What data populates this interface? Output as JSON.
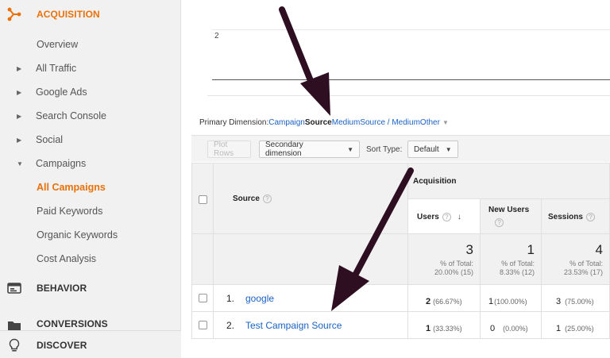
{
  "sidebar": {
    "acquisition": "ACQUISITION",
    "items": [
      {
        "label": "Overview"
      },
      {
        "label": "All Traffic"
      },
      {
        "label": "Google Ads"
      },
      {
        "label": "Search Console"
      },
      {
        "label": "Social"
      },
      {
        "label": "Campaigns"
      },
      {
        "label": "All Campaigns"
      },
      {
        "label": "Paid Keywords"
      },
      {
        "label": "Organic Keywords"
      },
      {
        "label": "Cost Analysis"
      }
    ],
    "behavior": "BEHAVIOR",
    "conversions": "CONVERSIONS",
    "discover": "DISCOVER",
    "accent": "#e8710a"
  },
  "chart": {
    "y_tick": "2"
  },
  "primary_dimension": {
    "label": "Primary Dimension:",
    "options": [
      "Campaign",
      "Source",
      "Medium",
      "Source / Medium",
      "Other"
    ],
    "active": "Source"
  },
  "toolbar": {
    "plot_rows": "Plot Rows",
    "secondary_dimension": "Secondary dimension",
    "sort_type_label": "Sort Type:",
    "sort_type_value": "Default"
  },
  "table": {
    "source_header": "Source",
    "group_header": "Acquisition",
    "columns": [
      "Users",
      "New Users",
      "Sessions"
    ],
    "totals": [
      {
        "value": "3",
        "pct_label": "% of Total:",
        "pct": "20.00% (15)"
      },
      {
        "value": "1",
        "pct_label": "% of Total:",
        "pct": "8.33% (12)"
      },
      {
        "value": "4",
        "pct_label": "% of Total:",
        "pct": "23.53% (17)"
      }
    ],
    "rows": [
      {
        "num": "1.",
        "source": "google",
        "users": "2",
        "users_pct": "(66.67%)",
        "new_users": "1",
        "new_users_pct": "(100.00%)",
        "sessions": "3",
        "sessions_pct": "(75.00%)"
      },
      {
        "num": "2.",
        "source": "Test Campaign Source",
        "users": "1",
        "users_pct": "(33.33%)",
        "new_users": "0",
        "new_users_pct": "(0.00%)",
        "sessions": "1",
        "sessions_pct": "(25.00%)"
      }
    ]
  }
}
